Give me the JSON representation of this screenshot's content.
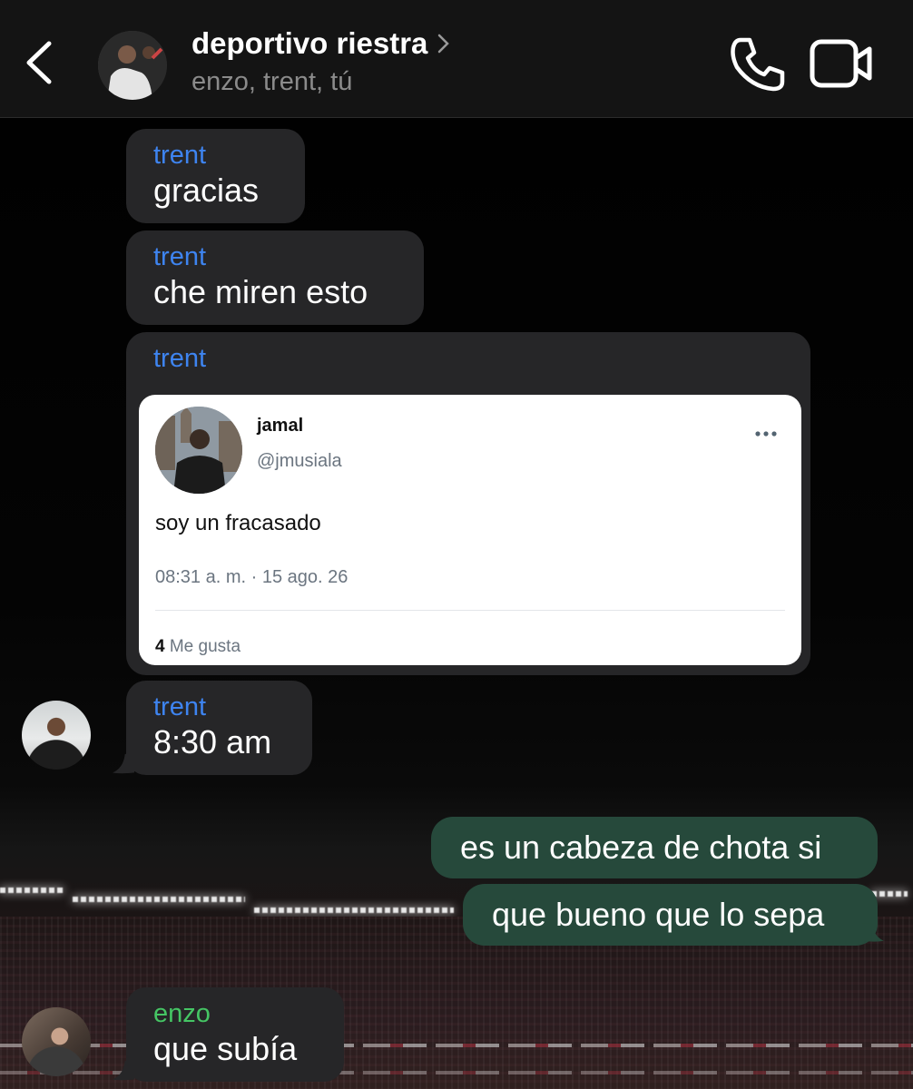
{
  "header": {
    "title": "deportivo riestra",
    "members": "enzo, trent, tú",
    "back_icon": "chevron-left-icon",
    "call_icon": "phone-icon",
    "video_icon": "video-camera-icon"
  },
  "messages": [
    {
      "sender": "trent",
      "text": "gracias"
    },
    {
      "sender": "trent",
      "text": "che miren esto"
    },
    {
      "sender": "trent",
      "tweet": {
        "name": "jamal",
        "handle": "@jmusiala",
        "text": "soy un fracasado",
        "time": "08:31 a. m. · 15 ago. 26",
        "likes_count": "4",
        "likes_label": "Me gusta"
      }
    },
    {
      "sender": "trent",
      "text": "8:30 am"
    },
    {
      "sender": "tú",
      "text": "es un cabeza de chota si"
    },
    {
      "sender": "tú",
      "text": "que bueno que lo sepa"
    },
    {
      "sender": "enzo",
      "text": "que subía"
    }
  ],
  "colors": {
    "sender_trent": "#3e84f0",
    "sender_enzo": "#45c564",
    "incoming_bubble": "#262628",
    "outgoing_bubble": "#26493b",
    "header_bg": "#141414"
  }
}
